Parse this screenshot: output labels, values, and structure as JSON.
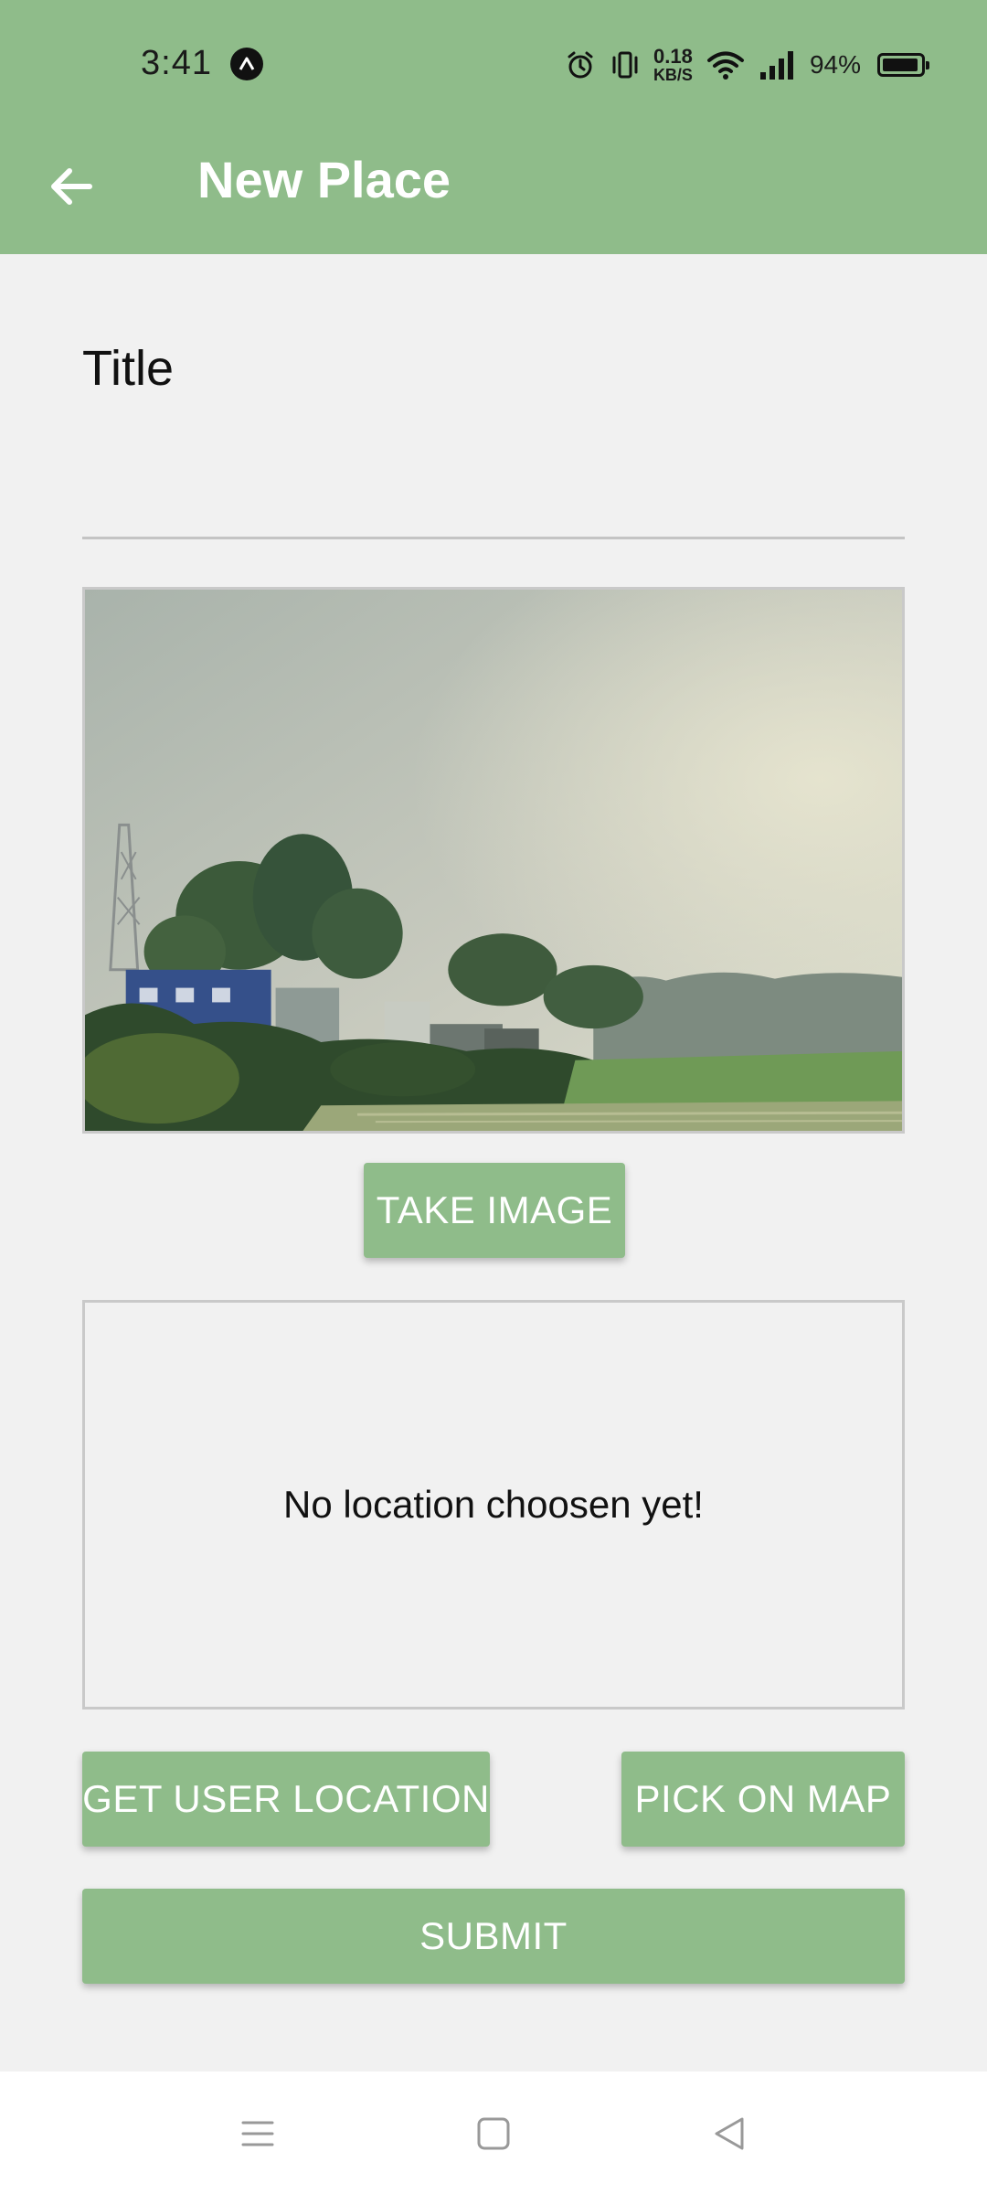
{
  "status_bar": {
    "time": "3:41",
    "app_icon": "a-logo-icon",
    "net_speed_value": "0.18",
    "net_speed_unit": "KB/S",
    "battery_percent": "94%",
    "battery_level": 0.94,
    "icons": [
      "alarm-icon",
      "vibrate-icon",
      "wifi-icon",
      "signal-icon",
      "battery-icon"
    ]
  },
  "toolbar": {
    "back_icon": "arrow-left-icon",
    "title": "New Place"
  },
  "form": {
    "title_label": "Title",
    "title_value": "",
    "image_preview": "photo-of-village-landscape",
    "take_image_label": "TAKE IMAGE",
    "location_placeholder": "No location choosen yet!",
    "get_user_location_label": "GET USER LOCATION",
    "pick_on_map_label": "PICK ON MAP",
    "submit_label": "SUBMIT"
  },
  "nav_bar": {
    "icons": [
      "menu-icon",
      "home-square-icon",
      "back-triangle-icon"
    ]
  },
  "colors": {
    "accent": "#8fbc8a",
    "background": "#f1f1f1",
    "text": "#111111",
    "button_text": "#ffffff"
  }
}
